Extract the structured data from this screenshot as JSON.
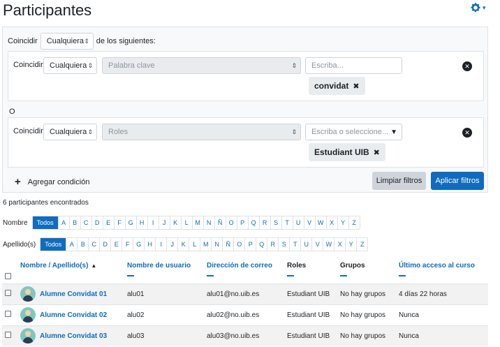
{
  "header": {
    "title": "Participantes",
    "settings_icon": "gear-icon"
  },
  "filters": {
    "match_label": "Coincidir",
    "match_value": "Cualquiera",
    "match_suffix": "de los siguientes:",
    "conditions": [
      {
        "label": "Coincidir",
        "match": "Cualquiera",
        "type": "Palabra clave",
        "input_placeholder": "Escriba...",
        "chip": "convidat"
      },
      {
        "label": "Coincidir",
        "match": "Cualquiera",
        "type": "Roles",
        "input_placeholder": "Escriba o seleccione...",
        "chip": "Estudiant UIB"
      }
    ],
    "or_label": "O",
    "add_condition": "Agregar condición",
    "clear_label": "Limpiar filtros",
    "apply_label": "Aplicar filtros"
  },
  "results_count": "6 participantes encontrados",
  "initials": {
    "first_label": "Nombre",
    "last_label": "Apellido(s)",
    "all_label": "Todos",
    "letters": [
      "A",
      "B",
      "C",
      "D",
      "E",
      "F",
      "G",
      "H",
      "I",
      "J",
      "K",
      "L",
      "M",
      "N",
      "Ñ",
      "O",
      "P",
      "Q",
      "R",
      "S",
      "T",
      "U",
      "V",
      "W",
      "X",
      "Y",
      "Z"
    ]
  },
  "table": {
    "headers": {
      "name": "Nombre / Apellido(s)",
      "username": "Nombre de usuario",
      "email": "Dirección de correo",
      "roles": "Roles",
      "groups": "Grupos",
      "last_access": "Último acceso al curso"
    },
    "rows": [
      {
        "name": "Alumne Convidat 01",
        "username": "alu01",
        "email": "alu01@no.uib.es",
        "role": "Estudiant UIB",
        "groups": "No hay grupos",
        "last_access": "4 días 22 horas"
      },
      {
        "name": "Alumne Convidat 02",
        "username": "alu02",
        "email": "alu02@no.uib.es",
        "role": "Estudiant UIB",
        "groups": "No hay grupos",
        "last_access": "Nunca"
      },
      {
        "name": "Alumne Convidat 03",
        "username": "alu03",
        "email": "alu03@no.uib.es",
        "role": "Estudiant UIB",
        "groups": "No hay grupos",
        "last_access": "Nunca"
      }
    ]
  },
  "colors": {
    "primary": "#0f6cbf",
    "row_stripe": "#f2f2f2",
    "filter_bg": "#f8f9fa"
  }
}
